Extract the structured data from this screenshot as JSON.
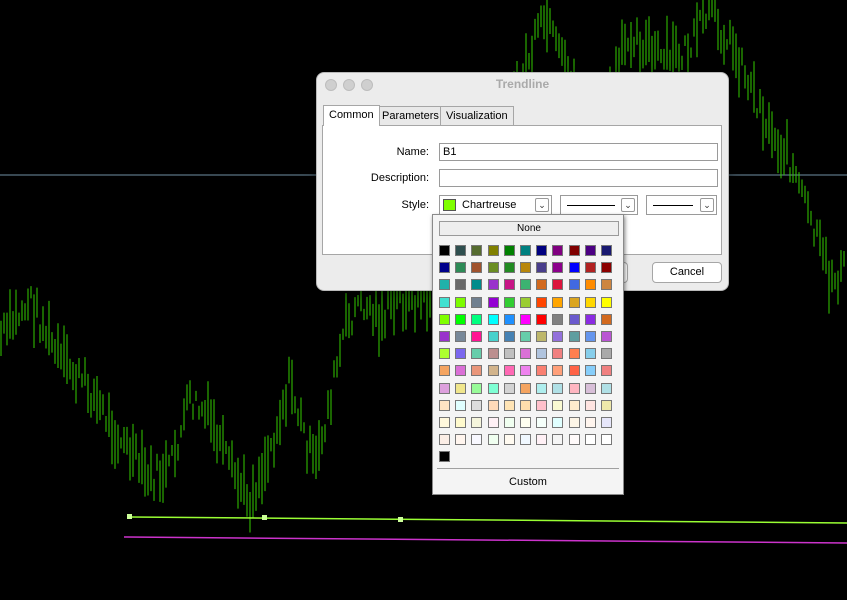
{
  "dialog": {
    "title": "Trendline",
    "tabs": [
      "Common",
      "Parameters",
      "Visualization"
    ],
    "active_tab": "Common",
    "fields": {
      "name_label": "Name:",
      "name_value": "B1",
      "description_label": "Description:",
      "description_value": "",
      "style_label": "Style:"
    },
    "style": {
      "color_name": "Chartreuse",
      "color_hex": "#7fff00"
    },
    "buttons": {
      "cancel": "Cancel"
    }
  },
  "palette": {
    "none_label": "None",
    "custom_label": "Custom",
    "colors": [
      [
        "#000000",
        "#2f4f4f",
        "#556b2f",
        "#808000",
        "#008000",
        "#008080",
        "#000080",
        "#800080",
        "#800000",
        "#4b0082",
        "#191970"
      ],
      [
        "#00008b",
        "#2e8b57",
        "#a0522d",
        "#6b8e23",
        "#228b22",
        "#b8860b",
        "#483d8b",
        "#8b008b",
        "#0000ff",
        "#b22222",
        "#8b0000"
      ],
      [
        "#20b2aa",
        "#696969",
        "#008b8b",
        "#9932cc",
        "#c71585",
        "#3cb371",
        "#d2691e",
        "#dc143c",
        "#4169e1",
        "#ff8c00",
        "#cd853f"
      ],
      [
        "#40e0d0",
        "#7cfc00",
        "#708090",
        "#9400d3",
        "#32cd32",
        "#9acd32",
        "#ff4500",
        "#ffa500",
        "#daa520",
        "#ffd700",
        "#ffff00"
      ],
      [
        "#7fff00",
        "#00ff00",
        "#00ff7f",
        "#00ffff",
        "#1e90ff",
        "#ff00ff",
        "#ff0000",
        "#808080",
        "#6a5acd",
        "#8a2be2",
        "#d2691e"
      ],
      [
        "#9932cc",
        "#778899",
        "#ff1493",
        "#48d1cc",
        "#4682b4",
        "#66cdaa",
        "#bdb76b",
        "#9370db",
        "#5f9ea0",
        "#6495ed",
        "#ba55d3"
      ],
      [
        "#adff2f",
        "#7b68ee",
        "#66cdaa",
        "#bc8f8f",
        "#c0c0c0",
        "#da70d6",
        "#b0c4de",
        "#f08080",
        "#ff7f50",
        "#87ceeb",
        "#a9a9a9"
      ],
      [
        "#f4a460",
        "#da70d6",
        "#e9967a",
        "#d2b48c",
        "#ff69b4",
        "#ee82ee",
        "#fa8072",
        "#ffa07a",
        "#ff6347",
        "#87cefa",
        "#f08080"
      ],
      [
        "#dda0dd",
        "#f0e68c",
        "#98fb98",
        "#7fffd4",
        "#d3d3d3",
        "#f4a460",
        "#afeeee",
        "#b0e0e6",
        "#ffb6c1",
        "#d8bfd8",
        "#b0e0e6"
      ],
      [
        "#ffe4c4",
        "#e0ffff",
        "#dcdcdc",
        "#ffdab9",
        "#ffe4b5",
        "#ffdead",
        "#ffc0cb",
        "#fafad2",
        "#ffebcd",
        "#ffe4e1",
        "#eee8aa"
      ],
      [
        "#fff8dc",
        "#fffacd",
        "#f5f5dc",
        "#fff0f5",
        "#f0fff0",
        "#fffff0",
        "#f5fffa",
        "#e0ffff",
        "#fdf5e6",
        "#fff5ee",
        "#e6e6fa"
      ],
      [
        "#fbeee6",
        "#fff5ee",
        "#f8f8ff",
        "#f0fff0",
        "#fffaf0",
        "#f0f8ff",
        "#fff0f5",
        "#f5f5f5",
        "#fffafa",
        "#ffffff",
        "#ffffff"
      ],
      [
        "#000000"
      ]
    ]
  },
  "chart": {
    "colors": {
      "bars": "#33cc00",
      "trendline": "#99ff33",
      "support_line": "#cc33cc",
      "horizontal_line": "#6f8fa3"
    }
  }
}
